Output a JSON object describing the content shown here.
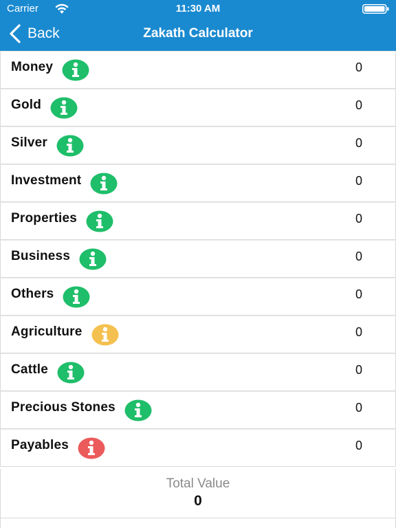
{
  "status_bar": {
    "carrier": "Carrier",
    "time": "11:30 AM",
    "wifi_icon": "wifi-icon",
    "battery_icon": "battery-icon"
  },
  "nav": {
    "back_label": "Back",
    "title": "Zakath Calculator",
    "back_icon": "chevron-left-icon"
  },
  "colors": {
    "header": "#1a8ad0",
    "info_green": "#1fbe6a",
    "info_yellow": "#f4c150",
    "info_red": "#ec5b5b"
  },
  "rows": [
    {
      "label": "Money",
      "value": "0",
      "info_color": "#1fbe6a"
    },
    {
      "label": "Gold",
      "value": "0",
      "info_color": "#1fbe6a"
    },
    {
      "label": "Silver",
      "value": "0",
      "info_color": "#1fbe6a"
    },
    {
      "label": "Investment",
      "value": "0",
      "info_color": "#1fbe6a"
    },
    {
      "label": "Properties",
      "value": "0",
      "info_color": "#1fbe6a"
    },
    {
      "label": "Business",
      "value": "0",
      "info_color": "#1fbe6a"
    },
    {
      "label": "Others",
      "value": "0",
      "info_color": "#1fbe6a"
    },
    {
      "label": "Agriculture",
      "value": "0",
      "info_color": "#f4c150"
    },
    {
      "label": "Cattle",
      "value": "0",
      "info_color": "#1fbe6a"
    },
    {
      "label": "Precious Stones",
      "value": "0",
      "info_color": "#1fbe6a"
    },
    {
      "label": "Payables",
      "value": "0",
      "info_color": "#ec5b5b"
    }
  ],
  "total": {
    "label": "Total Value",
    "value": "0"
  }
}
